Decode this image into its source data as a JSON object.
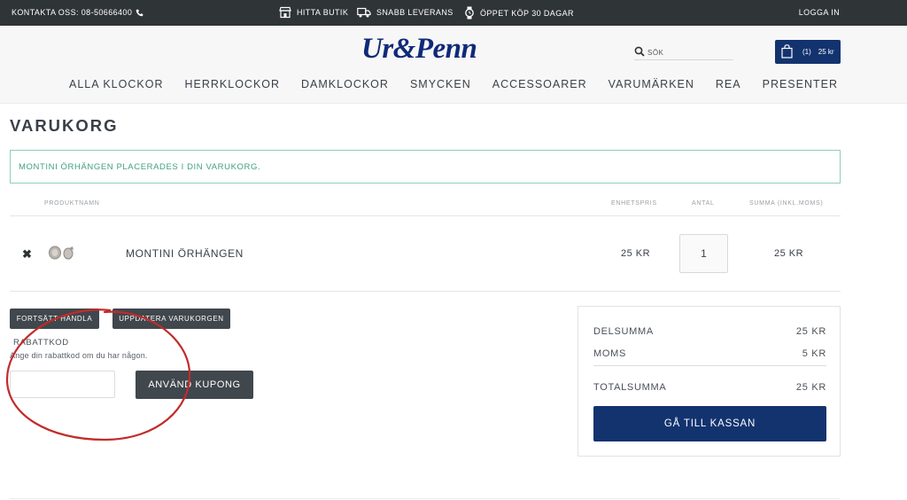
{
  "topbar": {
    "contact": "KONTAKTA OSS: 08-50666400",
    "store": "HITTA BUTIK",
    "shipping": "SNABB LEVERANS",
    "open_purchase": "ÖPPET KÖP 30 DAGAR",
    "login": "LOGGA IN"
  },
  "header": {
    "logo": "Ur&Penn",
    "search_placeholder": "SÖK",
    "cart_count": "(1)",
    "cart_total": "25 kr"
  },
  "nav": [
    "ALLA KLOCKOR",
    "HERRKLOCKOR",
    "DAMKLOCKOR",
    "SMYCKEN",
    "ACCESSOARER",
    "VARUMÄRKEN",
    "REA",
    "PRESENTER"
  ],
  "page": {
    "title": "VARUKORG",
    "notice": "MONTINI ÖRHÄNGEN PLACERADES I DIN VARUKORG."
  },
  "table": {
    "headers": {
      "product": "PRODUKTNAMN",
      "unit_price": "ENHETSPRIS",
      "quantity": "ANTAL",
      "sum": "SUMMA (INKL.MOMS)"
    },
    "rows": [
      {
        "name": "MONTINI ÖRHÄNGEN",
        "unit_price": "25 KR",
        "quantity": "1",
        "sum": "25 KR"
      }
    ]
  },
  "actions": {
    "continue": "FORTSÄTT HANDLA",
    "update": "UPPDATERA VARUKORGEN"
  },
  "coupon": {
    "label": "RABATTKOD",
    "help": "Ange din rabattkod om du har någon.",
    "value": "",
    "apply": "ANVÄND KUPONG"
  },
  "summary": {
    "subtotal_label": "DELSUMMA",
    "subtotal": "25 KR",
    "vat_label": "MOMS",
    "vat": "5 KR",
    "total_label": "TOTALSUMMA",
    "total": "25 KR",
    "checkout": "GÅ TILL KASSAN"
  },
  "colors": {
    "topbar": "#2f3436",
    "brand_navy": "#13336f",
    "notice_green": "#3fa181",
    "annotation_red": "#c22b2b"
  },
  "icons": [
    "phone-icon",
    "store-icon",
    "truck-icon",
    "watch-icon",
    "search-icon",
    "shopping-bag-icon",
    "close-icon"
  ]
}
